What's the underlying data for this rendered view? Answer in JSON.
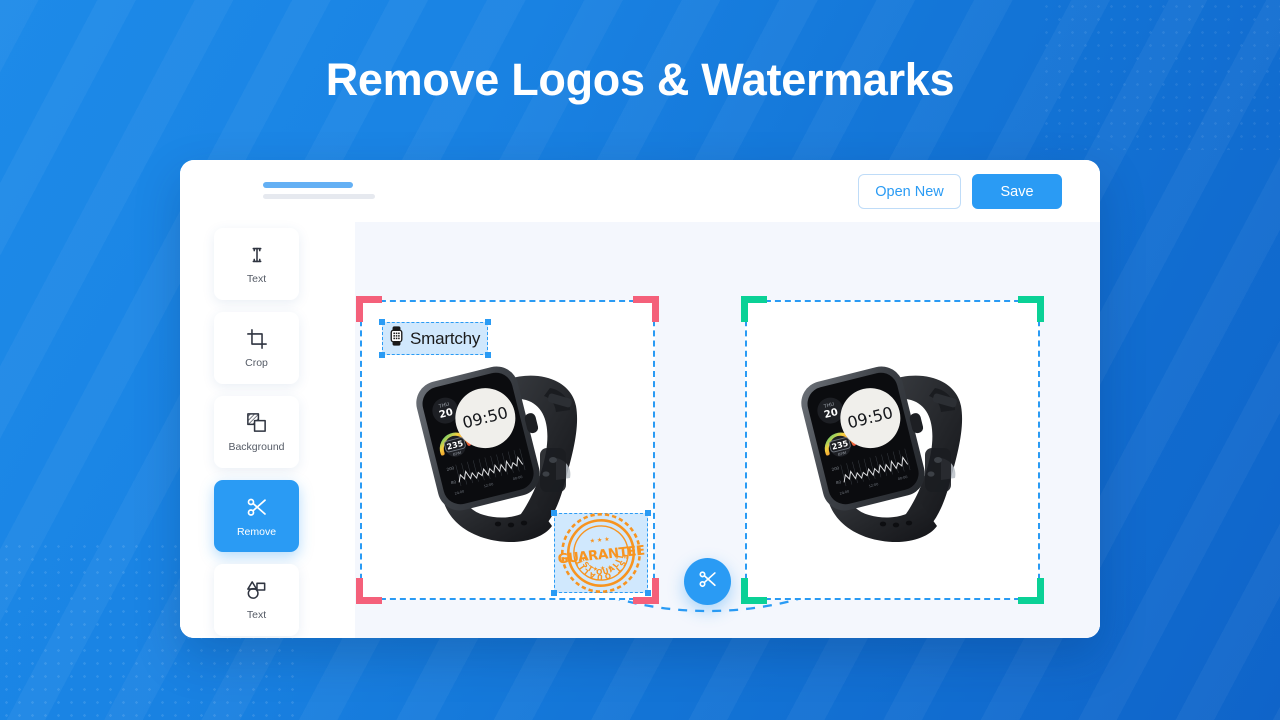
{
  "page": {
    "title_prefix": "Remove",
    "title_rest": " Logos & Watermarks",
    "bg_color": "#1374d6",
    "accent_color": "#2a9bf4"
  },
  "app": {
    "header": {
      "title_placeholder_bar": "",
      "subtitle_placeholder_bar": "",
      "open_new_label": "Open New",
      "save_label": "Save"
    },
    "sidebar": {
      "items": [
        {
          "label": "Text",
          "icon": "text-cursor-icon",
          "active": false
        },
        {
          "label": "Crop",
          "icon": "crop-icon",
          "active": false
        },
        {
          "label": "Background",
          "icon": "background-layers-icon",
          "active": false
        },
        {
          "label": "Remove",
          "icon": "scissors-icon",
          "active": true
        },
        {
          "label": "Text",
          "icon": "shapes-icon",
          "active": false
        }
      ]
    },
    "canvas": {
      "before_panel": {
        "corner_color": "#f4607a",
        "border_color": "#2a9bf4",
        "logo_watermark": {
          "text": "Smartchy",
          "icon": "smartwatch-icon"
        },
        "badge_watermark": {
          "top_text": "BEST QUALITY",
          "main_text": "GUARANTEE",
          "bottom_text": "BEST QUALITY",
          "color": "#f79420"
        }
      },
      "after_panel": {
        "corner_color": "#0ad196",
        "border_color": "#2a9bf4"
      },
      "watch": {
        "day_label": "THU",
        "date_value": "20",
        "time_value": "09:50",
        "bpm_value": "235",
        "bpm_unit": "BPM",
        "chart_max_label": "200",
        "chart_min_label": "80",
        "chart_x_labels": [
          "24:00",
          "12:00",
          "00:00"
        ]
      },
      "action_button": {
        "icon": "scissors-icon",
        "label": ""
      }
    }
  }
}
